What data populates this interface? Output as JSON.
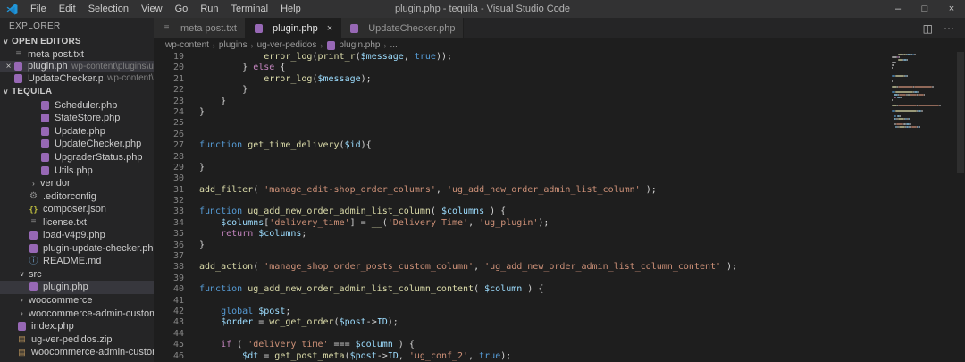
{
  "window": {
    "title": "plugin.php - tequila - Visual Studio Code",
    "menus": [
      "File",
      "Edit",
      "Selection",
      "View",
      "Go",
      "Run",
      "Terminal",
      "Help"
    ],
    "controls": {
      "minimize": "–",
      "maximize": "□",
      "close": "×"
    }
  },
  "colors": {
    "titlebar_bg": "#323233",
    "sidebar_bg": "#252526",
    "editor_bg": "#1e1e1e",
    "selection_bg": "#37373d",
    "php_icon": "#9768b5"
  },
  "sidebar": {
    "header": "EXPLORER",
    "open_editors_label": "OPEN EDITORS",
    "folder_label": "TEQUILA",
    "open_editors": [
      {
        "label": "meta post.txt",
        "icon": "txt",
        "path": "",
        "selected": false,
        "close": false
      },
      {
        "label": "plugin.php",
        "icon": "php",
        "path": "wp-content\\plugins\\ug...",
        "selected": true,
        "close": true
      },
      {
        "label": "UpdateChecker.php",
        "icon": "php",
        "path": "wp-content\\...",
        "selected": false,
        "close": false
      }
    ],
    "tree": [
      {
        "label": "Scheduler.php",
        "icon": "php",
        "indent": 3
      },
      {
        "label": "StateStore.php",
        "icon": "php",
        "indent": 3
      },
      {
        "label": "Update.php",
        "icon": "php",
        "indent": 3
      },
      {
        "label": "UpdateChecker.php",
        "icon": "php",
        "indent": 3
      },
      {
        "label": "UpgraderStatus.php",
        "icon": "php",
        "indent": 3
      },
      {
        "label": "Utils.php",
        "icon": "php",
        "indent": 3
      },
      {
        "label": "vendor",
        "icon": "folder-collapsed",
        "indent": 2
      },
      {
        "label": ".editorconfig",
        "icon": "gear",
        "indent": 2
      },
      {
        "label": "composer.json",
        "icon": "json",
        "indent": 2
      },
      {
        "label": "license.txt",
        "icon": "txt",
        "indent": 2
      },
      {
        "label": "load-v4p9.php",
        "icon": "php",
        "indent": 2
      },
      {
        "label": "plugin-update-checker.php",
        "icon": "php",
        "indent": 2
      },
      {
        "label": "README.md",
        "icon": "md",
        "indent": 2
      },
      {
        "label": "src",
        "icon": "folder-expanded",
        "indent": 1
      },
      {
        "label": "plugin.php",
        "icon": "php",
        "indent": 2,
        "selected": true
      },
      {
        "label": "woocommerce",
        "icon": "folder-collapsed",
        "indent": 1
      },
      {
        "label": "woocommerce-admin-custom-or...",
        "icon": "folder-collapsed",
        "indent": 1
      },
      {
        "label": "index.php",
        "icon": "php",
        "indent": 1
      },
      {
        "label": "ug-ver-pedidos.zip",
        "icon": "zip",
        "indent": 1
      },
      {
        "label": "woocommerce-admin-custom-or",
        "icon": "zip",
        "indent": 1
      }
    ]
  },
  "tabs": [
    {
      "label": "meta post.txt",
      "icon": "txt",
      "active": false,
      "close": false
    },
    {
      "label": "plugin.php",
      "icon": "php",
      "active": true,
      "close": true
    },
    {
      "label": "UpdateChecker.php",
      "icon": "php",
      "active": false,
      "close": false
    }
  ],
  "editor_actions": {
    "split": "◫",
    "more": "⋯"
  },
  "breadcrumb": [
    {
      "label": "wp-content"
    },
    {
      "label": "plugins"
    },
    {
      "label": "ug-ver-pedidos"
    },
    {
      "label": "plugin.php",
      "icon": "php"
    },
    {
      "label": "..."
    }
  ],
  "code": {
    "lines": [
      {
        "n": 19,
        "s": [
          [
            "p",
            "            "
          ],
          [
            "fn",
            "error_log"
          ],
          [
            "p",
            "("
          ],
          [
            "fn",
            "print_r"
          ],
          [
            "p",
            "("
          ],
          [
            "v",
            "$message"
          ],
          [
            "p",
            ", "
          ],
          [
            "c",
            "true"
          ],
          [
            "p",
            "));"
          ]
        ]
      },
      {
        "n": 20,
        "s": [
          [
            "p",
            "        } "
          ],
          [
            "ctl",
            "else"
          ],
          [
            "p",
            " {"
          ]
        ]
      },
      {
        "n": 21,
        "s": [
          [
            "p",
            "            "
          ],
          [
            "fn",
            "error_log"
          ],
          [
            "p",
            "("
          ],
          [
            "v",
            "$message"
          ],
          [
            "p",
            ");"
          ]
        ]
      },
      {
        "n": 22,
        "s": [
          [
            "p",
            "        }"
          ]
        ]
      },
      {
        "n": 23,
        "s": [
          [
            "p",
            "    }"
          ]
        ]
      },
      {
        "n": 24,
        "s": [
          [
            "p",
            "}"
          ]
        ]
      },
      {
        "n": 25,
        "s": []
      },
      {
        "n": 26,
        "s": []
      },
      {
        "n": 27,
        "s": [
          [
            "k",
            "function"
          ],
          [
            "fn",
            " get_time_delivery"
          ],
          [
            "p",
            "("
          ],
          [
            "v",
            "$id"
          ],
          [
            "p",
            "){"
          ]
        ]
      },
      {
        "n": 28,
        "s": []
      },
      {
        "n": 29,
        "s": [
          [
            "p",
            "}"
          ]
        ]
      },
      {
        "n": 30,
        "s": []
      },
      {
        "n": 31,
        "s": [
          [
            "fn",
            "add_filter"
          ],
          [
            "p",
            "( "
          ],
          [
            "s",
            "'manage_edit-shop_order_columns'"
          ],
          [
            "p",
            ", "
          ],
          [
            "s",
            "'ug_add_new_order_admin_list_column'"
          ],
          [
            "p",
            " );"
          ]
        ]
      },
      {
        "n": 32,
        "s": []
      },
      {
        "n": 33,
        "s": [
          [
            "k",
            "function"
          ],
          [
            "fn",
            " ug_add_new_order_admin_list_column"
          ],
          [
            "p",
            "( "
          ],
          [
            "v",
            "$columns"
          ],
          [
            "p",
            " ) {"
          ]
        ]
      },
      {
        "n": 34,
        "s": [
          [
            "p",
            "    "
          ],
          [
            "v",
            "$columns"
          ],
          [
            "p",
            "["
          ],
          [
            "s",
            "'delivery_time'"
          ],
          [
            "p",
            "] = "
          ],
          [
            "fn",
            "__"
          ],
          [
            "p",
            "("
          ],
          [
            "s",
            "'Delivery Time'"
          ],
          [
            "p",
            ", "
          ],
          [
            "s",
            "'ug_plugin'"
          ],
          [
            "p",
            ");"
          ]
        ]
      },
      {
        "n": 35,
        "s": [
          [
            "p",
            "    "
          ],
          [
            "ctl",
            "return"
          ],
          [
            "p",
            " "
          ],
          [
            "v",
            "$columns"
          ],
          [
            "p",
            ";"
          ]
        ]
      },
      {
        "n": 36,
        "s": [
          [
            "p",
            "}"
          ]
        ]
      },
      {
        "n": 37,
        "s": []
      },
      {
        "n": 38,
        "s": [
          [
            "fn",
            "add_action"
          ],
          [
            "p",
            "( "
          ],
          [
            "s",
            "'manage_shop_order_posts_custom_column'"
          ],
          [
            "p",
            ", "
          ],
          [
            "s",
            "'ug_add_new_order_admin_list_column_content'"
          ],
          [
            "p",
            " );"
          ]
        ]
      },
      {
        "n": 39,
        "s": []
      },
      {
        "n": 40,
        "s": [
          [
            "k",
            "function"
          ],
          [
            "fn",
            " ug_add_new_order_admin_list_column_content"
          ],
          [
            "p",
            "( "
          ],
          [
            "v",
            "$column"
          ],
          [
            "p",
            " ) {"
          ]
        ]
      },
      {
        "n": 41,
        "s": []
      },
      {
        "n": 42,
        "s": [
          [
            "p",
            "    "
          ],
          [
            "k",
            "global"
          ],
          [
            "p",
            " "
          ],
          [
            "v",
            "$post"
          ],
          [
            "p",
            ";"
          ]
        ]
      },
      {
        "n": 43,
        "s": [
          [
            "p",
            "    "
          ],
          [
            "v",
            "$order"
          ],
          [
            "p",
            " = "
          ],
          [
            "fn",
            "wc_get_order"
          ],
          [
            "p",
            "("
          ],
          [
            "v",
            "$post"
          ],
          [
            "p",
            "->"
          ],
          [
            "v",
            "ID"
          ],
          [
            "p",
            ");"
          ]
        ]
      },
      {
        "n": 44,
        "s": []
      },
      {
        "n": 45,
        "s": [
          [
            "p",
            "    "
          ],
          [
            "ctl",
            "if"
          ],
          [
            "p",
            " ( "
          ],
          [
            "s",
            "'delivery_time'"
          ],
          [
            "p",
            " === "
          ],
          [
            "v",
            "$column"
          ],
          [
            "p",
            " ) {"
          ]
        ]
      },
      {
        "n": 46,
        "s": [
          [
            "p",
            "        "
          ],
          [
            "v",
            "$dt"
          ],
          [
            "p",
            " = "
          ],
          [
            "fn",
            "get_post_meta"
          ],
          [
            "p",
            "("
          ],
          [
            "v",
            "$post"
          ],
          [
            "p",
            "->"
          ],
          [
            "v",
            "ID"
          ],
          [
            "p",
            ", "
          ],
          [
            "s",
            "'ug_conf_2'"
          ],
          [
            "p",
            ", "
          ],
          [
            "c",
            "true"
          ],
          [
            "p",
            ");"
          ]
        ]
      }
    ]
  }
}
